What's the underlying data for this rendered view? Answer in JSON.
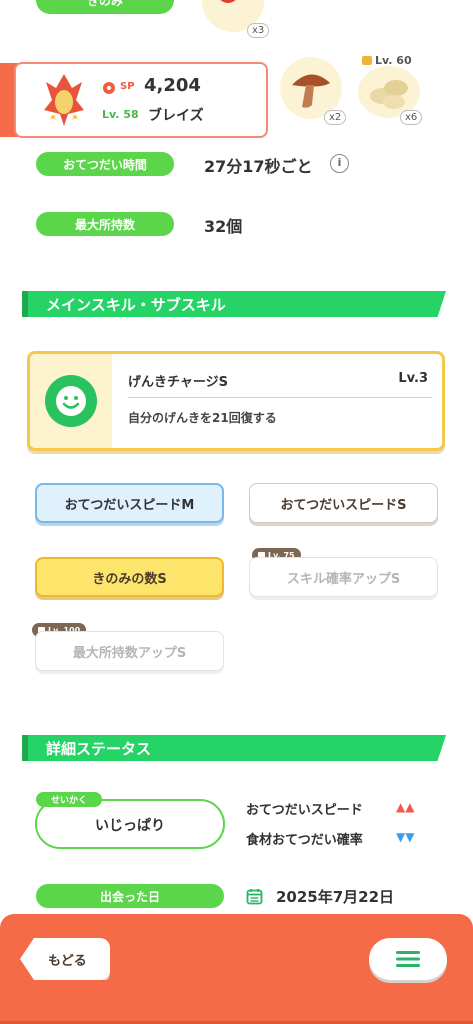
{
  "top": {
    "ingredient_label": "きのみ",
    "item_counts": [
      "x3",
      "x2",
      "x6"
    ],
    "locked_item_level": "Lv. 60"
  },
  "pokemon_card": {
    "sp_label": "SP",
    "strength": "4,204",
    "level": "Lv. 58",
    "name": "ブレイズ"
  },
  "stats": [
    {
      "label": "おてつだい時間",
      "value": "27分17秒ごと"
    },
    {
      "label": "最大所持数",
      "value": "32個"
    }
  ],
  "info_icon": "i",
  "main_skill_section": {
    "title": "メインスキル・サブスキル",
    "skill_name": "げんきチャージS",
    "skill_level": "Lv.3",
    "skill_desc": "自分のげんきを21回復する"
  },
  "sub_skills": [
    {
      "label": "おてつだいスピードM",
      "style": "blue",
      "lock": ""
    },
    {
      "label": "おてつだいスピードS",
      "style": "white",
      "lock": ""
    },
    {
      "label": "きのみの数S",
      "style": "yellow",
      "lock": ""
    },
    {
      "label": "スキル確率アップS",
      "style": "locked",
      "lock": "Lv. 75"
    },
    {
      "label": "最大所持数アップS",
      "style": "locked",
      "lock": "Lv. 100"
    }
  ],
  "detail_section": {
    "title": "詳細ステータス",
    "nature_tag": "せいかく",
    "nature": "いじっぱり",
    "up_label": "おてつだいスピード",
    "up_arrows": "▲▲",
    "down_label": "食材おてつだい確率",
    "down_arrows": "▼▼",
    "met_label": "出会った日",
    "met_date": "2025年7月22日"
  },
  "footer": {
    "back_label": "もどる",
    "menu_icon": "menu-icon"
  },
  "colors": {
    "accent_green": "#25d366",
    "pill_green": "#5bd54a",
    "footer_orange": "#f56a47",
    "up_red": "#f05a4a",
    "down_blue": "#3f9bf0"
  }
}
